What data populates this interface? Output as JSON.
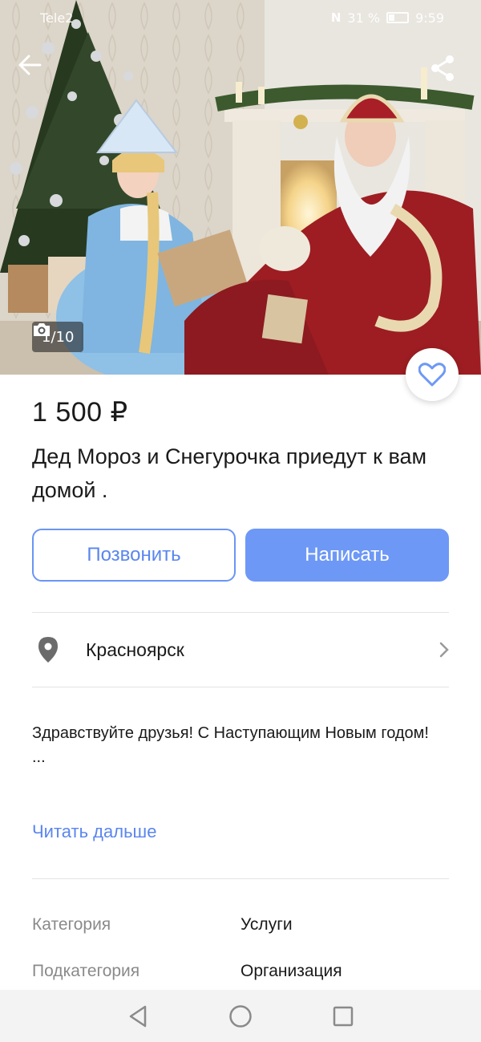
{
  "status_bar": {
    "carrier": "Tele2",
    "battery": "31 %",
    "time": "9:59",
    "nfc": "N"
  },
  "hero": {
    "photo_counter": "1/10"
  },
  "listing": {
    "price": "1 500 ₽",
    "title": "Дед Мороз и Снегурочка приедут к вам домой ."
  },
  "actions": {
    "call_label": "Позвонить",
    "write_label": "Написать"
  },
  "location": {
    "city": "Красноярск"
  },
  "description": {
    "text": "Здравствуйте друзья! С Наступающим Новым годом!",
    "ellipsis": "...",
    "read_more": "Читать дальше"
  },
  "params": [
    {
      "key": "Категория",
      "value": "Услуги"
    },
    {
      "key": "Подкатегория",
      "value": "Организация"
    }
  ],
  "colors": {
    "accent": "#6d98f6",
    "accent_text": "#5a86ee",
    "muted": "#8a8a8a"
  },
  "icons": {
    "back": "arrow-left-icon",
    "share": "share-icon",
    "camera": "camera-icon",
    "favorite": "heart-icon",
    "location": "map-pin-icon",
    "chevron": "chevron-right-icon",
    "nav_back": "triangle-back-icon",
    "nav_home": "circle-home-icon",
    "nav_recents": "square-recents-icon"
  }
}
